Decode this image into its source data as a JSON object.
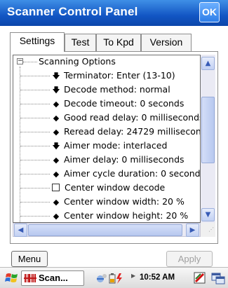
{
  "window": {
    "title": "Scanner Control Panel",
    "ok_label": "OK"
  },
  "tabs": [
    {
      "label": "Settings",
      "active": true
    },
    {
      "label": "Test",
      "active": false
    },
    {
      "label": "To Kpd",
      "active": false
    },
    {
      "label": "Version",
      "active": false
    }
  ],
  "tree": {
    "root": {
      "label": "Scanning Options",
      "expander": "−"
    },
    "items": [
      {
        "icon": "down-arrow-icon",
        "glyph": "🡇",
        "label": "Terminator: Enter (13-10)"
      },
      {
        "icon": "down-arrow-icon",
        "glyph": "🡇",
        "label": "Decode method: normal"
      },
      {
        "icon": "diamond-icon",
        "glyph": "◆",
        "label": "Decode timeout: 0 seconds"
      },
      {
        "icon": "diamond-icon",
        "glyph": "◆",
        "label": "Good read delay: 0 milliseconds"
      },
      {
        "icon": "diamond-icon",
        "glyph": "◆",
        "label": "Reread delay: 24729 millisecon"
      },
      {
        "icon": "down-arrow-icon",
        "glyph": "🡇",
        "label": "Aimer mode: interlaced"
      },
      {
        "icon": "diamond-icon",
        "glyph": "◆",
        "label": "Aimer delay: 0 milliseconds"
      },
      {
        "icon": "diamond-icon",
        "glyph": "◆",
        "label": "Aimer cycle duration: 0 second:"
      },
      {
        "icon": "checkbox-icon",
        "glyph": "",
        "label": "Center window decode"
      },
      {
        "icon": "diamond-icon",
        "glyph": "◆",
        "label": "Center window width: 20 %"
      },
      {
        "icon": "diamond-icon",
        "glyph": "◆",
        "label": "Center window height: 20 %"
      }
    ]
  },
  "scrollbar": {
    "up": "▲",
    "down": "▼",
    "left": "◀",
    "right": "▶"
  },
  "buttons": {
    "menu": "Menu",
    "apply": "Apply"
  },
  "taskbar": {
    "app_label": "Scan...",
    "clock": "10:52 AM"
  },
  "colors": {
    "title_bar": "#1256c4",
    "taskbar_app_icon": "#c01818"
  }
}
